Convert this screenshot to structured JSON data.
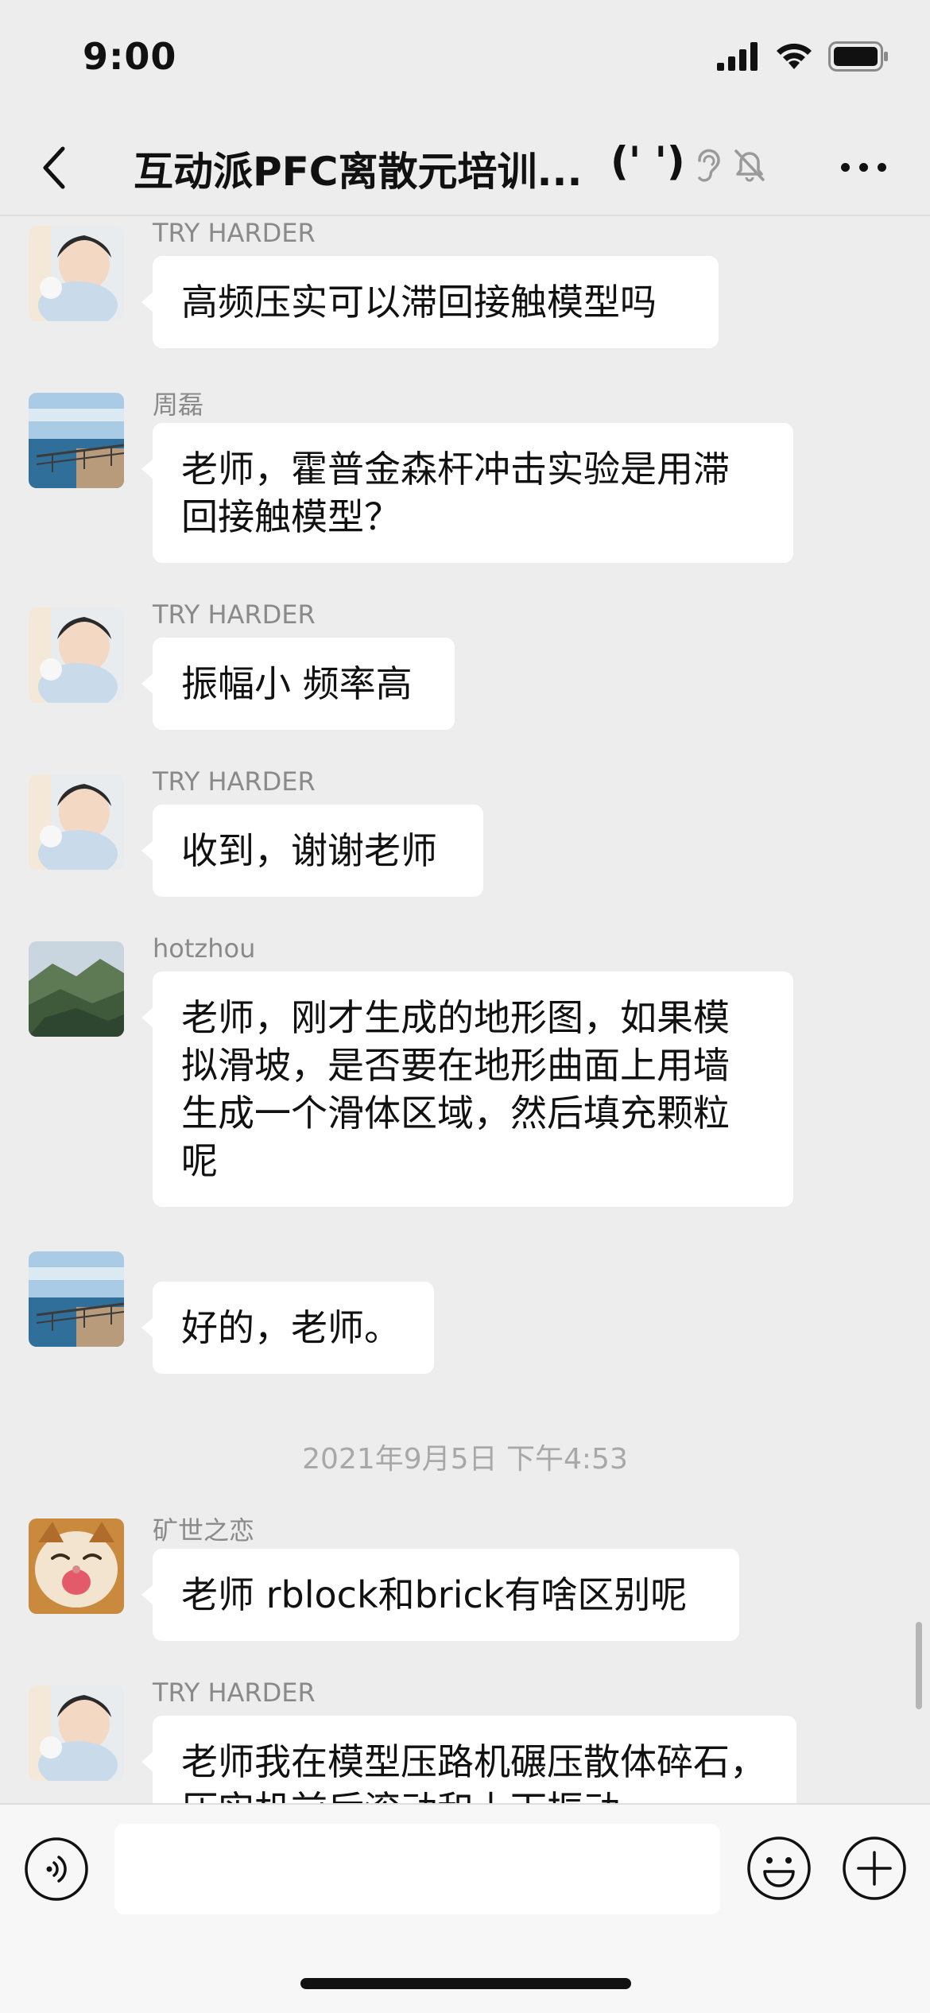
{
  "status_bar": {
    "time": "9:00"
  },
  "nav": {
    "title": "互动派PFC离散元培训...",
    "count": "(' ')",
    "back_icon": "chevron-left-icon",
    "more_icon": "more-horizontal-icon"
  },
  "messages": [
    {
      "sender": "TRY HARDER",
      "text": "高频压实可以滞回接触模型吗",
      "avatar": "child-photo"
    },
    {
      "sender": "周磊",
      "text": "老师，霍普金森杆冲击实验是用滞回接触模型？",
      "avatar": "seaside-photo"
    },
    {
      "sender": "TRY HARDER",
      "text": "振幅小 频率高",
      "avatar": "child-photo"
    },
    {
      "sender": "TRY HARDER",
      "text": "收到，谢谢老师",
      "avatar": "child-photo"
    },
    {
      "sender": "hotzhou",
      "text": "老师，刚才生成的地形图，如果模拟滑坡，是否要在地形曲面上用墙生成一个滑体区域，然后填充颗粒呢",
      "avatar": "mountain-photo"
    },
    {
      "sender": "",
      "text": "好的，老师。",
      "avatar": "seaside-photo"
    },
    {
      "sender": "矿世之恋",
      "text": "老师 rblock和brick有啥区别呢",
      "avatar": "cat-photo"
    },
    {
      "sender": "TRY HARDER",
      "text": "老师我在模型压路机碾压散体碎石，压实机前后滚动和上下振动",
      "avatar": "child-photo"
    }
  ],
  "timestamp": "2021年9月5日 下午4:53",
  "input_bar": {
    "placeholder": ""
  },
  "colors": {
    "background": "#ededed",
    "bubble": "#ffffff",
    "sender": "#8a8a8a",
    "timestamp": "#a8a8a8"
  }
}
